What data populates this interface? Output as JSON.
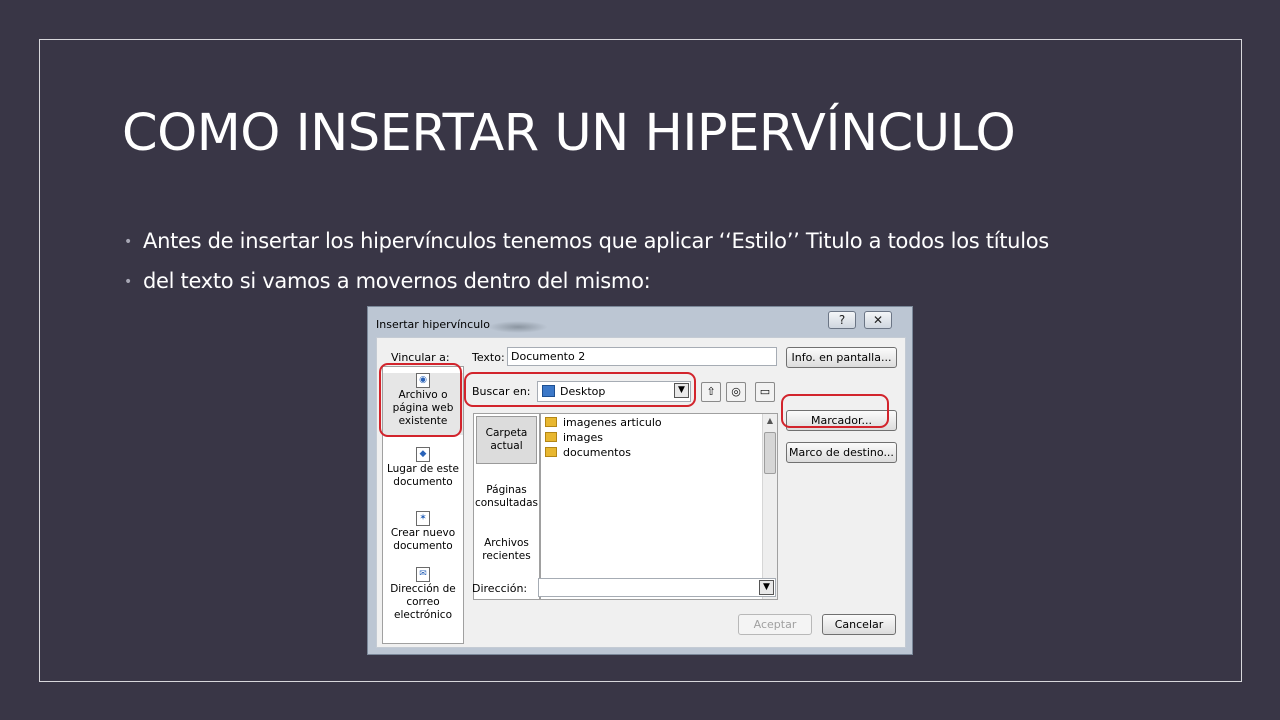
{
  "slide": {
    "title": "COMO INSERTAR UN HIPERVÍNCULO",
    "bullets": [
      "Antes de insertar los hipervínculos tenemos que aplicar ‘‘Estilo’’ Titulo a todos los títulos",
      "del texto si vamos a movernos dentro del mismo:"
    ]
  },
  "dialog": {
    "title": "Insertar hipervínculo",
    "help_glyph": "?",
    "close_glyph": "✕",
    "vincular_label": "Vincular a:",
    "texto_label": "Texto:",
    "texto_value": "Documento 2",
    "info_button": "Info. en pantalla...",
    "buscar_label": "Buscar en:",
    "buscar_value": "Desktop",
    "marcador_button": "Marcador...",
    "marco_button": "Marco de destino...",
    "link_types": [
      {
        "line1": "Archivo o",
        "line2": "página web",
        "line3": "existente"
      },
      {
        "line1": "Lugar de este",
        "line2": "documento",
        "line3": ""
      },
      {
        "line1": "Crear nuevo",
        "line2": "documento",
        "line3": ""
      },
      {
        "line1": "Dirección de",
        "line2": "correo",
        "line3": "electrónico"
      }
    ],
    "left_nav": [
      {
        "line1": "Carpeta",
        "line2": "actual"
      },
      {
        "line1": "Páginas",
        "line2": "consultadas"
      },
      {
        "line1": "Archivos",
        "line2": "recientes"
      }
    ],
    "files": [
      "imagenes articulo",
      "images",
      "documentos"
    ],
    "direccion_label": "Dirección:",
    "direccion_value": "",
    "aceptar_button": "Aceptar",
    "cancelar_button": "Cancelar"
  },
  "colors": {
    "background": "#393646",
    "annotation_red": "#d2242c"
  }
}
